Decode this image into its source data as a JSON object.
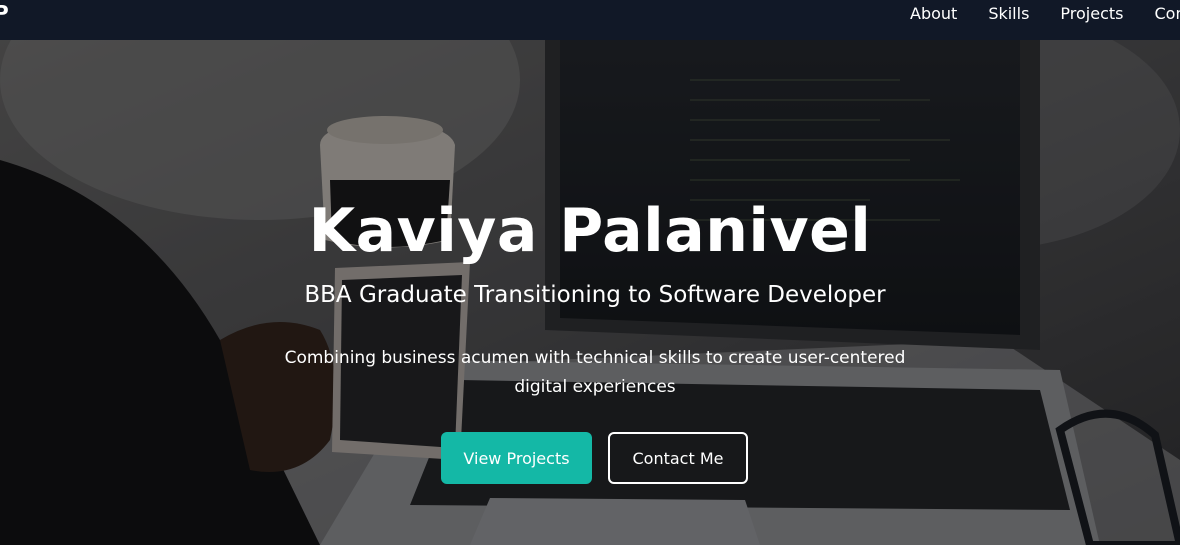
{
  "nav": {
    "logo": "P",
    "links": [
      "About",
      "Skills",
      "Projects",
      "Con"
    ]
  },
  "hero": {
    "title": "Kaviya Palanivel",
    "subtitle": "BBA Graduate Transitioning to Software Developer",
    "description": "Combining business acumen with technical skills to create user-centered digital experiences",
    "primary_button": "View Projects",
    "secondary_button": "Contact Me"
  },
  "colors": {
    "nav_bg": "#111827",
    "accent": "#14b8a6",
    "text": "#ffffff"
  }
}
